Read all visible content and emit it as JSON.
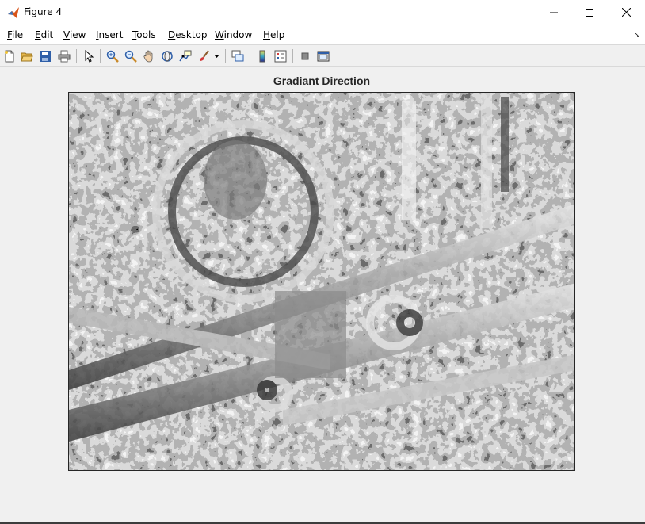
{
  "window": {
    "title": "Figure 4",
    "minimize_icon": "minimize-icon",
    "maximize_icon": "maximize-icon",
    "close_icon": "close-icon",
    "app_icon": "matlab-icon"
  },
  "menubar": {
    "items": [
      {
        "first": "F",
        "rest": "ile"
      },
      {
        "first": "E",
        "rest": "dit"
      },
      {
        "first": "V",
        "rest": "iew"
      },
      {
        "first": "I",
        "rest": "nsert"
      },
      {
        "first": "T",
        "rest": "ools"
      },
      {
        "first": "D",
        "rest": "esktop"
      },
      {
        "first": "W",
        "rest": "indow"
      },
      {
        "first": "H",
        "rest": "elp"
      }
    ],
    "overflow_icon": "chevron-right-icon"
  },
  "toolbar": {
    "icons": [
      "new-figure-icon",
      "open-file-icon",
      "save-icon",
      "print-icon",
      "pointer-icon",
      "zoom-in-icon",
      "zoom-out-icon",
      "pan-icon",
      "rotate-3d-icon",
      "data-cursor-icon",
      "brush-icon",
      "link-plot-icon",
      "colorbar-icon",
      "legend-icon",
      "hide-plot-tools-icon",
      "show-plot-tools-icon"
    ]
  },
  "plot": {
    "title": "Gradiant Direction",
    "image": "grayscale-gradient-direction-map"
  }
}
